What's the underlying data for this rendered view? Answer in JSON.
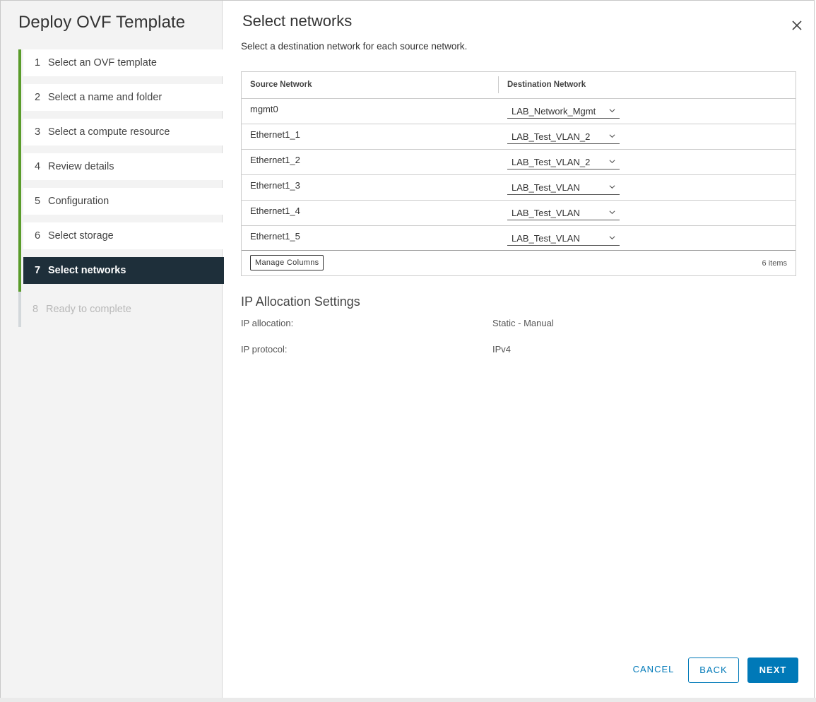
{
  "wizard": {
    "title": "Deploy OVF Template",
    "steps": [
      {
        "num": "1",
        "label": "Select an OVF template",
        "state": "done"
      },
      {
        "num": "2",
        "label": "Select a name and folder",
        "state": "done"
      },
      {
        "num": "3",
        "label": "Select a compute resource",
        "state": "done"
      },
      {
        "num": "4",
        "label": "Review details",
        "state": "done"
      },
      {
        "num": "5",
        "label": "Configuration",
        "state": "done"
      },
      {
        "num": "6",
        "label": "Select storage",
        "state": "done"
      },
      {
        "num": "7",
        "label": "Select networks",
        "state": "active"
      },
      {
        "num": "8",
        "label": "Ready to complete",
        "state": "disabled"
      }
    ]
  },
  "page": {
    "title": "Select networks",
    "subtitle": "Select a destination network for each source network."
  },
  "grid": {
    "columns": {
      "source": "Source Network",
      "destination": "Destination Network"
    },
    "rows": [
      {
        "source": "mgmt0",
        "destination": "LAB_Network_Mgmt"
      },
      {
        "source": "Ethernet1_1",
        "destination": "LAB_Test_VLAN_2"
      },
      {
        "source": "Ethernet1_2",
        "destination": "LAB_Test_VLAN_2"
      },
      {
        "source": "Ethernet1_3",
        "destination": "LAB_Test_VLAN"
      },
      {
        "source": "Ethernet1_4",
        "destination": "LAB_Test_VLAN"
      },
      {
        "source": "Ethernet1_5",
        "destination": "LAB_Test_VLAN"
      }
    ],
    "manage_columns_label": "Manage Columns",
    "item_count": "6 items"
  },
  "ip_settings": {
    "title": "IP Allocation Settings",
    "allocation_label": "IP allocation:",
    "allocation_value": "Static - Manual",
    "protocol_label": "IP protocol:",
    "protocol_value": "IPv4"
  },
  "buttons": {
    "cancel": "CANCEL",
    "back": "BACK",
    "next": "NEXT"
  },
  "icons": {
    "close": "close-icon",
    "dropdown": "chevron-down-icon"
  },
  "colors": {
    "accent": "#0079b8",
    "active_step": "#1e2f3a",
    "completed_bar": "#5a9c2b"
  }
}
